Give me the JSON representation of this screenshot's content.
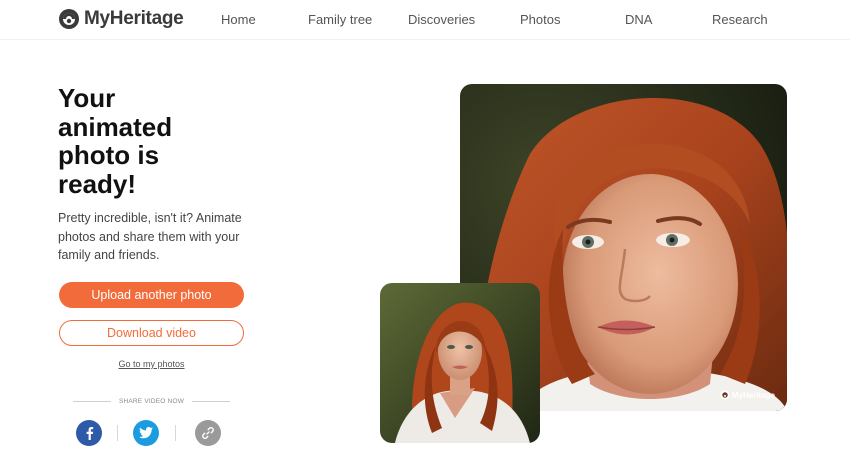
{
  "header": {
    "logo_text": "MyHeritage",
    "nav": [
      "Home",
      "Family tree",
      "Discoveries",
      "Photos",
      "DNA",
      "Research"
    ]
  },
  "main": {
    "headline": "Your animated photo is ready!",
    "subtext": "Pretty incredible, isn't it? Animate photos and share them with your family and friends.",
    "upload_button": "Upload another photo",
    "download_button": "Download video",
    "photos_link": "Go to my photos",
    "share_label": "SHARE VIDEO NOW",
    "social": [
      "facebook-icon",
      "twitter-icon",
      "link-icon"
    ]
  },
  "photos": {
    "watermark": "MyHeritage"
  },
  "colors": {
    "accent": "#f26c3b",
    "facebook": "#2f5aa8",
    "twitter": "#1d9be0",
    "link": "#9a9a9a"
  }
}
